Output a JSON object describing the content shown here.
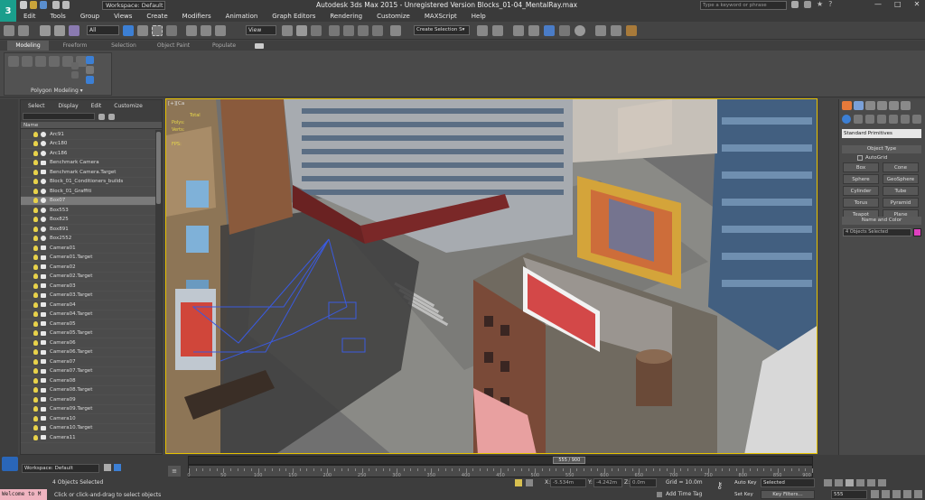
{
  "title_bar": {
    "workspace": "Workspace: Default",
    "title": "Autodesk 3ds Max  2015   -  Unregistered Version    Blocks_01-04_MentalRay.max",
    "search_placeholder": "Type a keyword or phrase"
  },
  "menu": [
    "Edit",
    "Tools",
    "Group",
    "Views",
    "Create",
    "Modifiers",
    "Animation",
    "Graph Editors",
    "Rendering",
    "Customize",
    "MAXScript",
    "Help"
  ],
  "toolbar": {
    "filter": "All",
    "ref_coord": "View",
    "selection_set": "Create Selection S▾"
  },
  "ribbon": {
    "tabs": [
      "Modeling",
      "Freeform",
      "Selection",
      "Object Paint",
      "Populate"
    ],
    "active_tab": "Modeling",
    "group_label": "Polygon Modeling ▾"
  },
  "scene_explorer": {
    "menu": [
      "Select",
      "Display",
      "Edit",
      "Customize"
    ],
    "header": "Name",
    "rows": [
      {
        "name": "Arc91",
        "kind": "o"
      },
      {
        "name": "Arc180",
        "kind": "o"
      },
      {
        "name": "Arc186",
        "kind": "o"
      },
      {
        "name": "Benchmark Camera",
        "kind": "c"
      },
      {
        "name": "Benchmark Camera.Target",
        "kind": "c"
      },
      {
        "name": "Block_01_Conditioners_builds",
        "kind": "o"
      },
      {
        "name": "Block_01_Graffiti",
        "kind": "o"
      },
      {
        "name": "Box07",
        "kind": "o",
        "sel": true
      },
      {
        "name": "Box553",
        "kind": "o"
      },
      {
        "name": "Box825",
        "kind": "o"
      },
      {
        "name": "Box891",
        "kind": "o"
      },
      {
        "name": "Box2552",
        "kind": "o"
      },
      {
        "name": "Camera01",
        "kind": "c"
      },
      {
        "name": "Camera01.Target",
        "kind": "c"
      },
      {
        "name": "Camera02",
        "kind": "c"
      },
      {
        "name": "Camera02.Target",
        "kind": "c"
      },
      {
        "name": "Camera03",
        "kind": "c"
      },
      {
        "name": "Camera03.Target",
        "kind": "c"
      },
      {
        "name": "Camera04",
        "kind": "c"
      },
      {
        "name": "Camera04.Target",
        "kind": "c"
      },
      {
        "name": "Camera05",
        "kind": "c"
      },
      {
        "name": "Camera05.Target",
        "kind": "c"
      },
      {
        "name": "Camera06",
        "kind": "c"
      },
      {
        "name": "Camera06.Target",
        "kind": "c"
      },
      {
        "name": "Camera07",
        "kind": "c"
      },
      {
        "name": "Camera07.Target",
        "kind": "c"
      },
      {
        "name": "Camera08",
        "kind": "c"
      },
      {
        "name": "Camera08.Target",
        "kind": "c"
      },
      {
        "name": "Camera09",
        "kind": "c"
      },
      {
        "name": "Camera09.Target",
        "kind": "c"
      },
      {
        "name": "Camera10",
        "kind": "c"
      },
      {
        "name": "Camera10.Target",
        "kind": "c"
      },
      {
        "name": "Camera11",
        "kind": "c"
      }
    ],
    "workspace": "Workspace: Default"
  },
  "viewport": {
    "label": "[+][Ca",
    "stats": [
      "Total",
      "Polys:",
      "Verts:",
      "",
      "FPS:"
    ]
  },
  "command_panel": {
    "category": "Standard Primitives",
    "object_type_title": "Object Type",
    "autogrid": "AutoGrid",
    "primitives": [
      "Box",
      "Cone",
      "Sphere",
      "GeoSphere",
      "Cylinder",
      "Tube",
      "Torus",
      "Pyramid",
      "Teapot",
      "Plane"
    ],
    "name_color_title": "Name and Color",
    "name_value": "4 Objects Selected",
    "swatch_color": "#e040c0"
  },
  "timeline": {
    "frame": "555 / 900",
    "progress": 0.6167,
    "ticks": [
      0,
      50,
      100,
      150,
      200,
      250,
      300,
      350,
      400,
      450,
      500,
      550,
      600,
      650,
      700,
      750,
      800,
      850,
      900
    ]
  },
  "status": {
    "listener": "Welcome to M",
    "selected": "4 Objects Selected",
    "prompt": "Click or click-and-drag to select objects",
    "x_label": "X:",
    "x_value": "-5.534m",
    "y_label": "Y:",
    "y_value": "-4.242m",
    "z_label": "Z:",
    "z_value": "0.0m",
    "grid": "Grid = 10.0m",
    "add_time_tag": "Add Time Tag",
    "auto_key": "Auto Key",
    "set_key": "Set Key",
    "key_mode": "Selected",
    "key_filters": "Key Filters...",
    "frame_field": "555"
  }
}
